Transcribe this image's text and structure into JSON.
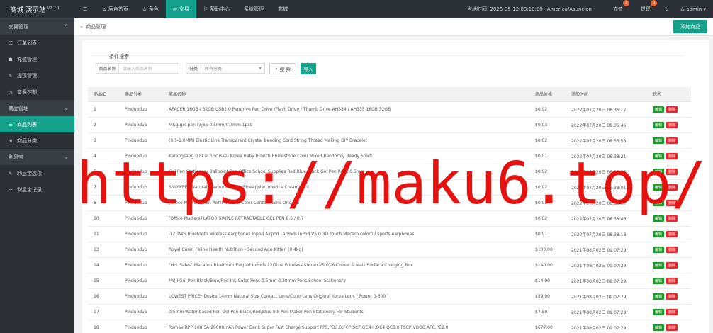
{
  "brand": {
    "name": "商城 演示站",
    "version": "V2.2.1"
  },
  "topnav": {
    "menu_icon": "☰",
    "items": [
      {
        "icon": "⌂",
        "label": "后台首页"
      },
      {
        "icon": "♙",
        "label": "角色"
      },
      {
        "icon": "⇄",
        "label": "交易"
      },
      {
        "icon": "⚐",
        "label": "帮助中心"
      },
      {
        "icon": "",
        "label": "系统管理"
      },
      {
        "icon": "",
        "label": "商城"
      }
    ],
    "active_index": 2
  },
  "topright": {
    "time_label": "当地时间: 2025-05-12 08:10:09",
    "timezone": "America/Asuncion",
    "recharge_label": "充值",
    "recharge_badge": "3",
    "withdraw_label": "提现",
    "withdraw_badge": "0",
    "refresh_icon": "↻",
    "user_icon": "♙",
    "username": "admin"
  },
  "sidebar": {
    "groups": [
      {
        "label": "交易管理",
        "items": [
          {
            "icon": "☷",
            "label": "订单列表"
          },
          {
            "icon": "☗",
            "label": "充值管理"
          },
          {
            "icon": "✎",
            "label": "提现管理"
          },
          {
            "icon": "◷",
            "label": "交易控制"
          }
        ]
      },
      {
        "label": "商品管理",
        "items": [
          {
            "icon": "☰",
            "label": "商品列表"
          },
          {
            "icon": "⊞",
            "label": "商品分类"
          }
        ]
      },
      {
        "label": "利息宝",
        "items": [
          {
            "icon": "✎",
            "label": "利息宝选项"
          },
          {
            "icon": "☷",
            "label": "利息宝记录"
          }
        ]
      }
    ]
  },
  "breadcrumb": {
    "icon": "»",
    "label": "商品管理"
  },
  "add_button": "添加商品",
  "search": {
    "legend": "条件搜索",
    "name_label": "商品名称",
    "name_placeholder": "请输入商品名称",
    "category_label": "分类",
    "category_value": "所有分类",
    "search_button": "搜 索",
    "search_icon": "⌕",
    "import_button": "导入"
  },
  "table": {
    "headers": [
      "商品ID",
      "商品分类",
      "商品名称",
      "商品价格",
      "添加时间",
      "状态"
    ],
    "edit_label": "编辑",
    "delete_label": "删除",
    "rows": [
      [
        "1",
        "Pinduoduo",
        "APACER 16GB / 32GB USB2.0 Pendrive Pen Drive /Flash Drive / Thumb Drive AH334 / AH335 16GB 32GB",
        "$0.02",
        "2022年07月20日 08:36:17"
      ],
      [
        "2",
        "Pinduoduo",
        "M&g gel pen r3j65 0.5mm/0.7mm 1pcs",
        "$0.03",
        "2022年07月20日 08:35:46"
      ],
      [
        "3",
        "Pinduoduo",
        "(0.5-1.0MM) Elastic Line Transparent Crystal Beading Cord String Thread Making DIY Bracelet",
        "$0.02",
        "2022年07月20日 08:35:58"
      ],
      [
        "4",
        "Pinduoduo",
        "Kerongsang 0.8CM 1pc Batu Korea Baby Brooch Rhinestone Color Mixed Randomly Ready Stock",
        "$0.01",
        "2022年07月20日 08:38:21"
      ],
      [
        "5",
        "Pinduoduo",
        "Gel Pen Stationery Ballpoint Pen Office School Supplies Red Blue Black Gel Pen Refill 0.5mm",
        "$0.02",
        "2022年07月20日 08:38:55"
      ],
      [
        "7",
        "Pinduoduo",
        "SNOWPEA Natural Flavour - Grape/Pineapple/Lime/Ice Cream/Mint",
        "$0.02",
        "2022年07月20日 08:38:01"
      ],
      [
        "8",
        "Pinduoduo",
        "[Office Matters] Pen Refill Natural Color Contact Lens Original",
        "$0.02",
        "2022年07月20日 08:38:07"
      ],
      [
        "10",
        "Pinduoduo",
        "[Office Matters] LATOR SIMPLE RETRACTABLE GEL PEN 0.5 / 0.7",
        "$0.02",
        "2022年07月20日 08:38:46"
      ],
      [
        "11",
        "Pinduoduo",
        "i12 TWS Bluetooth wireless earphones Inpod Airpod LarPods inPod V5.0 3D Touch Macaro colorful sports earphones",
        "$0.01",
        "2022年07月20日 08:38:13"
      ],
      [
        "13",
        "Pinduoduo",
        "Royal Canin Feline Health Nutrition - Second Age Kitten (0.4kg)",
        "$100.00",
        "2021年08月02日 09:07:29"
      ],
      [
        "14",
        "Pinduoduo",
        "\"Hot Sales\" Macaron Bluetooth Earpad InPods 12(True Wireless Stereo V5.0)-6 Colour & Matt Surface Charging Box",
        "$140.00",
        "2021年08月02日 09:07:29"
      ],
      [
        "15",
        "Pinduoduo",
        "MUJI Gel Pen Black/Blue/Red Ink Color Pens 0.5mm 0.38mm Pens School Stationary",
        "$14.90",
        "2021年08月02日 09:07:29"
      ],
      [
        "16",
        "Pinduoduo",
        "LOWEST PRICE* Desire 14mm Natural Size Contact Lens/Color Lens Original Korea Lens ( Power 0-600 )",
        "$59.00",
        "2021年08月02日 09:07:29"
      ],
      [
        "17",
        "Pinduoduo",
        "0.5mm Water-based Pen Gel Pen Black/Red/Blue Ink Pen Maker Pen Stationery For Students",
        "$7.50",
        "2021年08月02日 09:07:29"
      ],
      [
        "18",
        "Pinduoduo",
        "Remax RPP-108 5A 20000mAh Power Bank Super Fast Charge Support PPS,PD3.0,FCP,SCP,QC4+,QC4,QC3.0,FSCP,VOOC,AFC,PE2.0",
        "$677.00",
        "2021年08月02日 09:07:29"
      ]
    ]
  },
  "watermark": "https://maku6.top/"
}
